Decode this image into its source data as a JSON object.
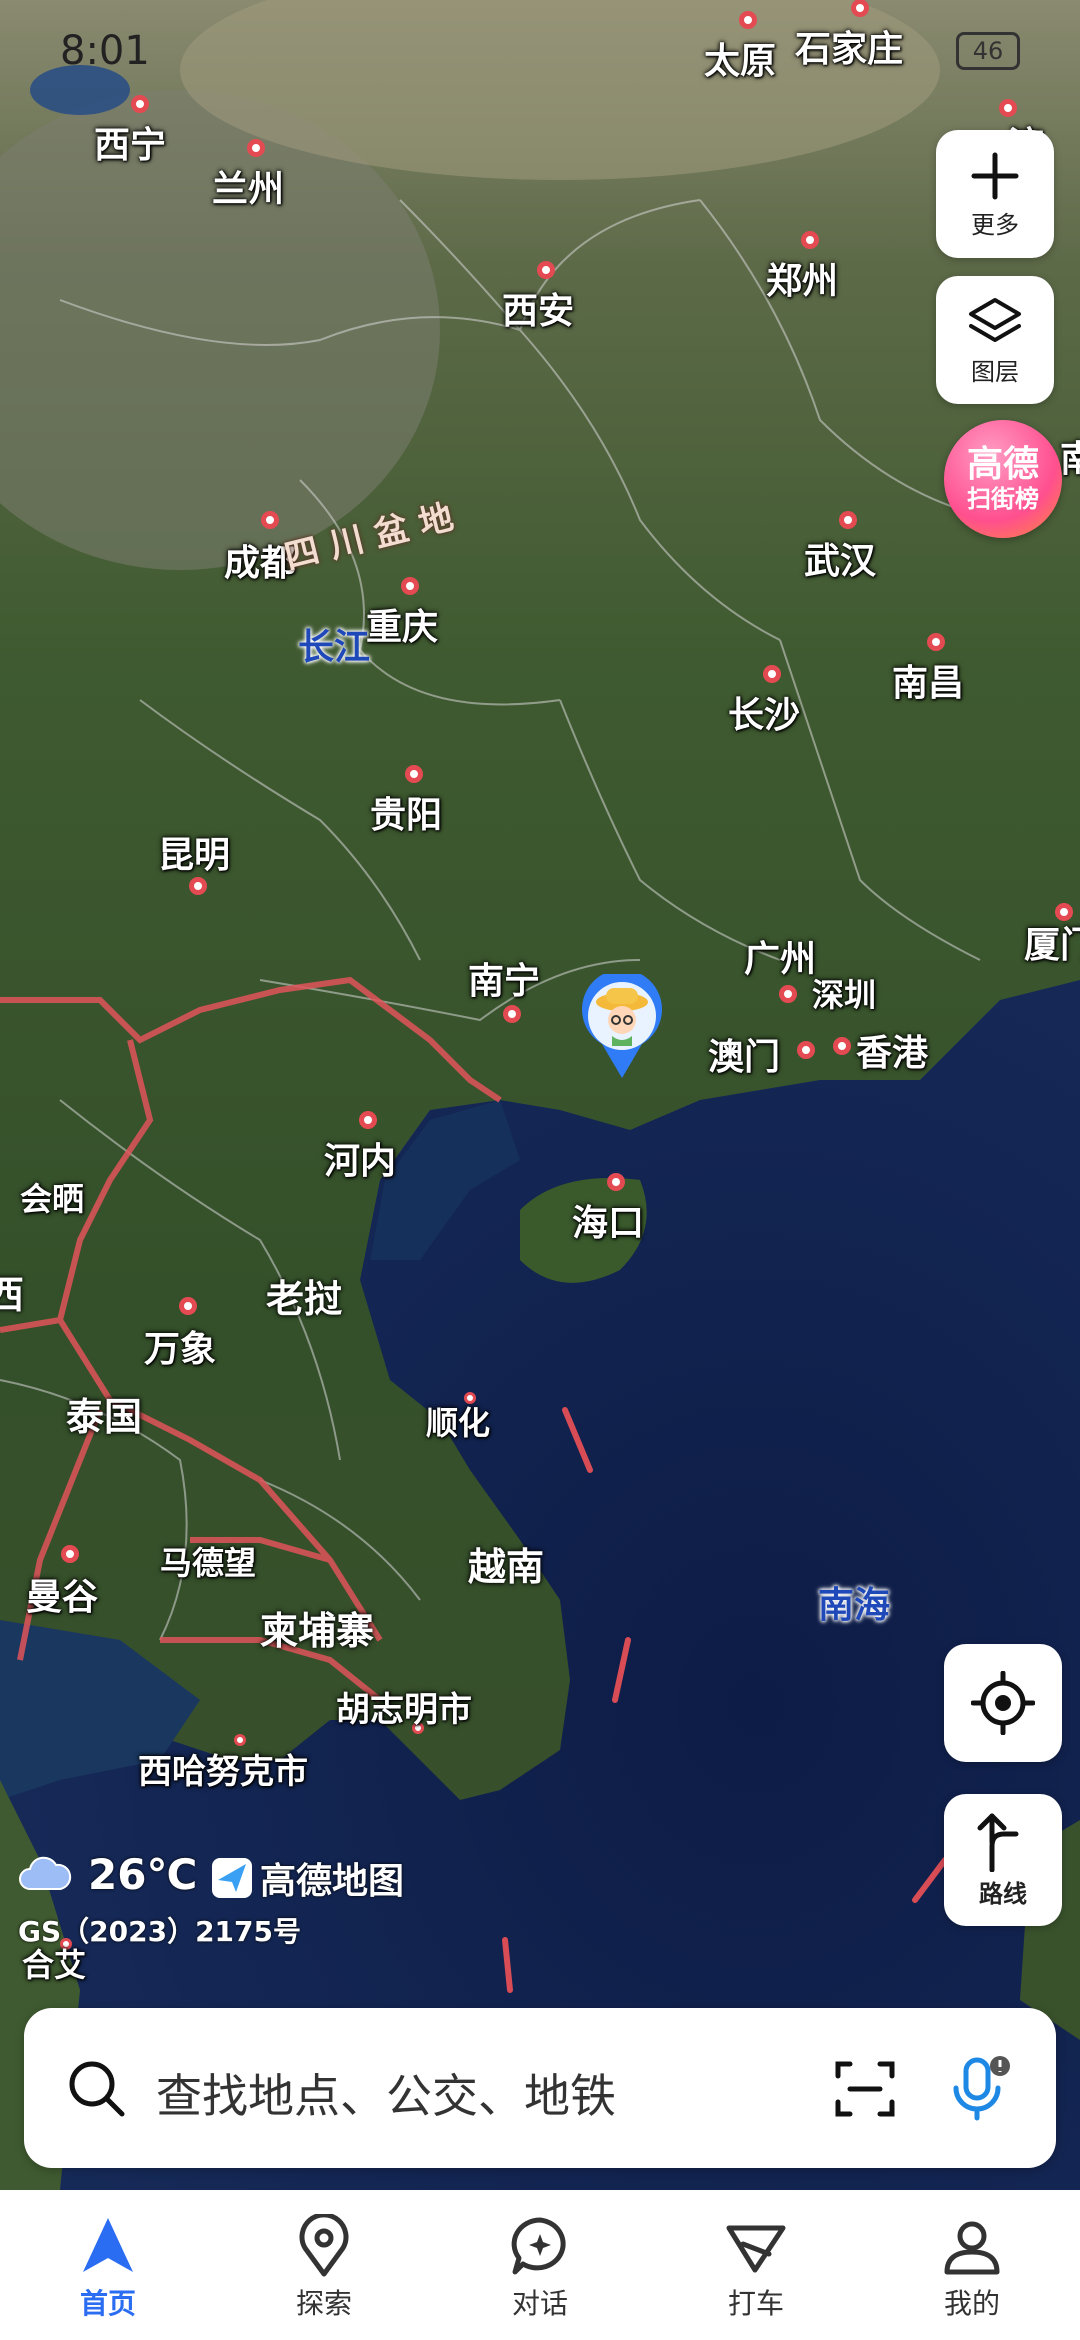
{
  "status": {
    "time": "8:01",
    "battery": "46"
  },
  "map_controls": {
    "more_label": "更多",
    "layers_label": "图层",
    "route_label": "路线"
  },
  "promo": {
    "line1": "高德",
    "line2": "扫街榜"
  },
  "cities": {
    "xining": "西宁",
    "lanzhou": "兰州",
    "taiyuan": "太原",
    "shijiazhuang": "石家庄",
    "zhengzhou": "郑州",
    "xian": "西安",
    "chengdu": "成都",
    "chongqing": "重庆",
    "wuhan": "武汉",
    "changsha": "长沙",
    "nanchang": "南昌",
    "guiyang": "贵阳",
    "kunming": "昆明",
    "nanning": "南宁",
    "guangzhou": "广州",
    "shenzhen": "深圳",
    "aomen": "澳门",
    "xianggang": "香港",
    "xiamen": "厦门",
    "hanoi": "河内",
    "haikou": "海口",
    "huisai": "会晒",
    "vientiane": "万象",
    "hue": "顺化",
    "bangkok": "曼谷",
    "madewang": "马德望",
    "hcmc": "胡志明市",
    "sihanouk": "西哈努克市",
    "hefei": "合艾",
    "nan_partial": "南",
    "jiang_partial": "济"
  },
  "regions": {
    "laos": "老挝",
    "thailand": "泰国",
    "vietnam": "越南",
    "cambodia": "柬埔寨",
    "edge_left": "西"
  },
  "water": {
    "changjiang": "长江",
    "south_sea": "南海"
  },
  "basin": "四川盆地",
  "weather": {
    "temp": "26℃"
  },
  "brand": "高德地图",
  "license": "GS（2023）2175号",
  "search": {
    "placeholder": "查找地点、公交、地铁"
  },
  "tabs": [
    {
      "label": "首页",
      "icon": "navigation-arrow-icon"
    },
    {
      "label": "探索",
      "icon": "location-pin-icon"
    },
    {
      "label": "对话",
      "icon": "chat-bubble-icon"
    },
    {
      "label": "打车",
      "icon": "taxi-flag-icon"
    },
    {
      "label": "我的",
      "icon": "profile-icon"
    }
  ]
}
